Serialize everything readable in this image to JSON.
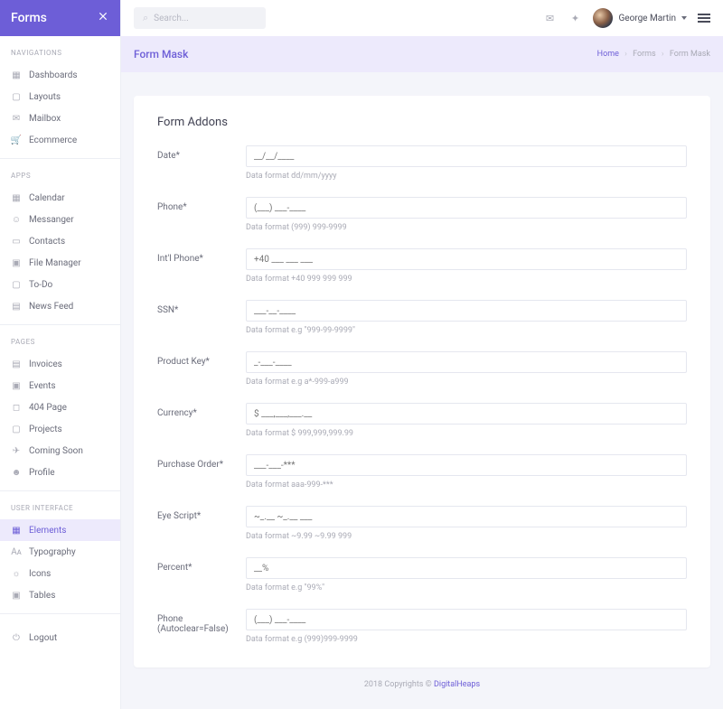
{
  "brand": "Forms",
  "search": {
    "placeholder": "Search..."
  },
  "user": {
    "name": "George Martin"
  },
  "page": {
    "title": "Form Mask"
  },
  "crumbs": {
    "home": "Home",
    "forms": "Forms",
    "current": "Form Mask"
  },
  "card": {
    "title": "Form Addons"
  },
  "nav": {
    "h1": "NAVIGATIONS",
    "h2": "APPS",
    "h3": "PAGES",
    "h4": "USER INTERFACE",
    "dashboards": "Dashboards",
    "layouts": "Layouts",
    "mailbox": "Mailbox",
    "ecommerce": "Ecommerce",
    "calendar": "Calendar",
    "messanger": "Messanger",
    "contacts": "Contacts",
    "filemgr": "File Manager",
    "todo": "To-Do",
    "newsfeed": "News Feed",
    "invoices": "Invoices",
    "events": "Events",
    "p404": "404 Page",
    "projects": "Projects",
    "comingsoon": "Coming Soon",
    "profile": "Profile",
    "elements": "Elements",
    "typography": "Typography",
    "icons": "Icons",
    "tables": "Tables",
    "logout": "Logout"
  },
  "fields": {
    "date": {
      "label": "Date*",
      "ph": "__/__/____",
      "help": "Data format dd/mm/yyyy"
    },
    "phone": {
      "label": "Phone*",
      "ph": "(___) ___-____",
      "help": "Data format (999) 999-9999"
    },
    "intl": {
      "label": "Int'l Phone*",
      "ph": "+40 ___ ___ ___",
      "help": "Data format +40 999 999 999"
    },
    "ssn": {
      "label": "SSN*",
      "ph": "___-__-____",
      "help": "Data format e.g \"999-99-9999\""
    },
    "pkey": {
      "label": "Product Key*",
      "ph": "_-___-____",
      "help": "Data format e.g a*-999-a999"
    },
    "currency": {
      "label": "Currency*",
      "ph": "$ ___,___,___.__",
      "help": "Data format $ 999,999,999.99"
    },
    "po": {
      "label": "Purchase Order*",
      "ph": "___-___-***",
      "help": "Data format aaa-999-***"
    },
    "eye": {
      "label": "Eye Script*",
      "ph": "~_.__ ~_.__ ___",
      "help": "Data format ~9.99 ~9.99 999"
    },
    "percent": {
      "label": "Percent*",
      "ph": "__%",
      "help": "Data format e.g \"99%\""
    },
    "phone2": {
      "label": "Phone (Autoclear=False)",
      "ph": "(___) ___-____",
      "help": "Data format e.g (999)999-9999"
    }
  },
  "footer": {
    "text": "2018 Copyrights © ",
    "link": "DigitalHeaps"
  }
}
